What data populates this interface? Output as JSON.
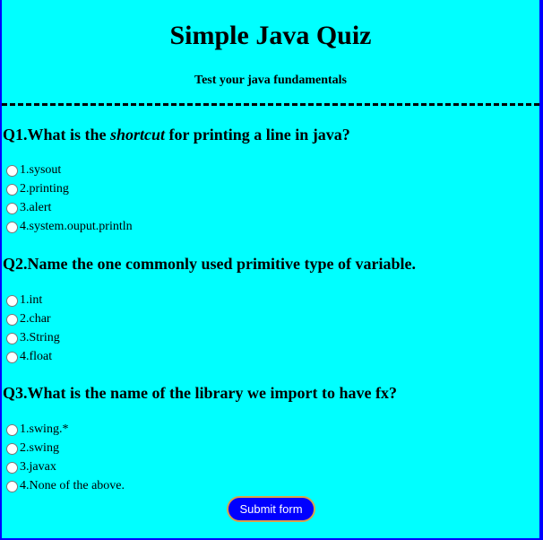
{
  "header": {
    "title": "Simple Java Quiz",
    "subtitle": "Test your java fundamentals"
  },
  "questions": [
    {
      "pre": "Q1.What is the ",
      "em": "shortcut",
      "post": " for printing a line in java?",
      "options": [
        "1.sysout",
        "2.printing",
        "3.alert",
        "4.system.ouput.println"
      ]
    },
    {
      "pre": "Q2.Name the one commonly used primitive type of variable.",
      "em": "",
      "post": "",
      "options": [
        "1.int",
        "2.char",
        "3.String",
        "4.float"
      ]
    },
    {
      "pre": "Q3.What is the name of the library we import to have fx?",
      "em": "",
      "post": "",
      "options": [
        "1.swing.*",
        "2.swing",
        "3.javax",
        "4.None of the above."
      ]
    }
  ],
  "submit_label": "Submit form"
}
